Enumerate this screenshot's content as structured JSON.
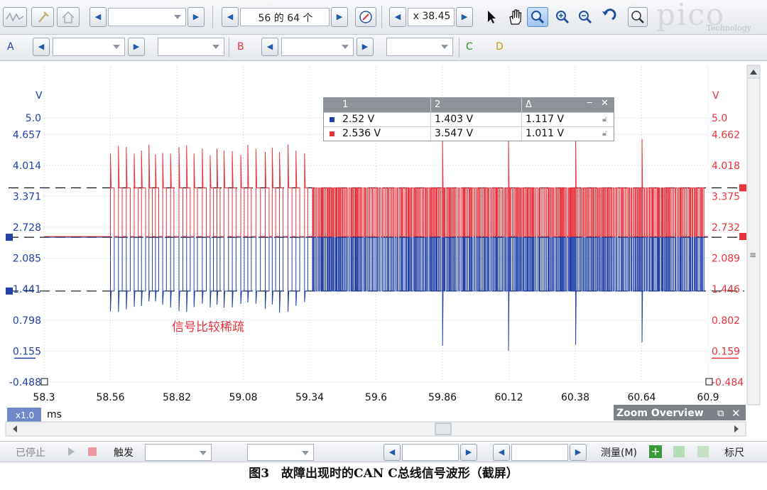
{
  "toolbar1": {
    "page_counter": "56 的 64 个",
    "zoom_value": "x 38.45",
    "brand": "pico",
    "brand_sub": "Technology"
  },
  "toolbar2": {
    "channel_a": "A",
    "channel_b": "B",
    "channel_c": "C",
    "channel_d": "D"
  },
  "scope": {
    "left_unit": "V",
    "right_unit": "V",
    "left_ticks": [
      "5.0",
      "4.657",
      "4.014",
      "3.371",
      "2.728",
      "2.085",
      "1.441",
      "0.798",
      "0.155",
      "-0.488"
    ],
    "right_ticks": [
      "5.0",
      "4.662",
      "4.018",
      "3.375",
      "2.732",
      "2.089",
      "1.446",
      "0.802",
      "0.159",
      "-0.484"
    ],
    "x_ticks": [
      "58.3",
      "58.56",
      "58.82",
      "59.08",
      "59.34",
      "59.6",
      "59.86",
      "60.12",
      "60.38",
      "60.64",
      "60.9"
    ],
    "x_unit": "ms",
    "zoom_badge": "x1.0",
    "annotation": "信号比较稀疏",
    "colors": {
      "channel_a": "#2040a8",
      "channel_b": "#e8323c"
    }
  },
  "chart_data": {
    "type": "line",
    "xlabel": "ms",
    "ylabel": "V",
    "xlim": [
      58.3,
      60.9
    ],
    "ylim": [
      -0.488,
      5.0
    ],
    "series": [
      {
        "name": "A",
        "recessive_v": 2.52,
        "dominant_v": 1.403,
        "spike_min_v": 0.15
      },
      {
        "name": "B",
        "recessive_v": 2.536,
        "dominant_v": 3.547,
        "spike_max_v": 4.6
      }
    ],
    "notes": "Traffic sparse from 58.56 to 59.34 ms; dense from 59.34 to 60.9 ms"
  },
  "measure_table": {
    "headers": [
      "1",
      "2",
      "Δ"
    ],
    "rows": [
      {
        "v1": "2.52 V",
        "v2": "1.403 V",
        "delta": "1.117 V"
      },
      {
        "v1": "2.536 V",
        "v2": "3.547 V",
        "delta": "1.011 V"
      }
    ]
  },
  "zoom_overview": {
    "title": "Zoom Overview"
  },
  "bottom_toolbar": {
    "stop_label": "已停止",
    "trigger_label": "触发",
    "measure_label": "测量(M)",
    "ruler_label": "标尺"
  },
  "caption": "图3　故障出现时的CAN C总线信号波形（截屏）"
}
